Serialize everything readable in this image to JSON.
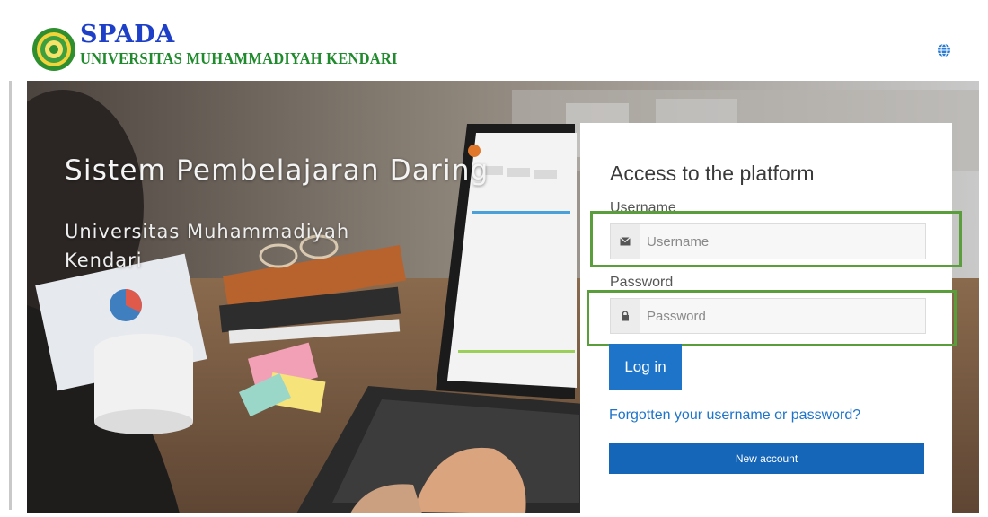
{
  "brand": {
    "title": "SPADA",
    "subtitle": "UNIVERSITAS MUHAMMADIYAH KENDARI",
    "title_color": "#1e40c8",
    "subtitle_color": "#1f8b2c"
  },
  "header": {
    "language_icon": "globe-icon"
  },
  "hero": {
    "title": "Sistem Pembelajaran Daring",
    "subtitle": "Universitas Muhammadiyah Kendari"
  },
  "login": {
    "heading": "Access to the platform",
    "username_label": "Username",
    "username_placeholder": "Username",
    "username_icon": "envelope-icon",
    "password_label": "Password",
    "password_placeholder": "Password",
    "password_icon": "lock-icon",
    "login_button": "Log in",
    "forgot_link": "Forgotten your username or password?",
    "new_account_button": "New account",
    "accent_color": "#1d74c9",
    "highlight_color": "#5a9e3c"
  }
}
